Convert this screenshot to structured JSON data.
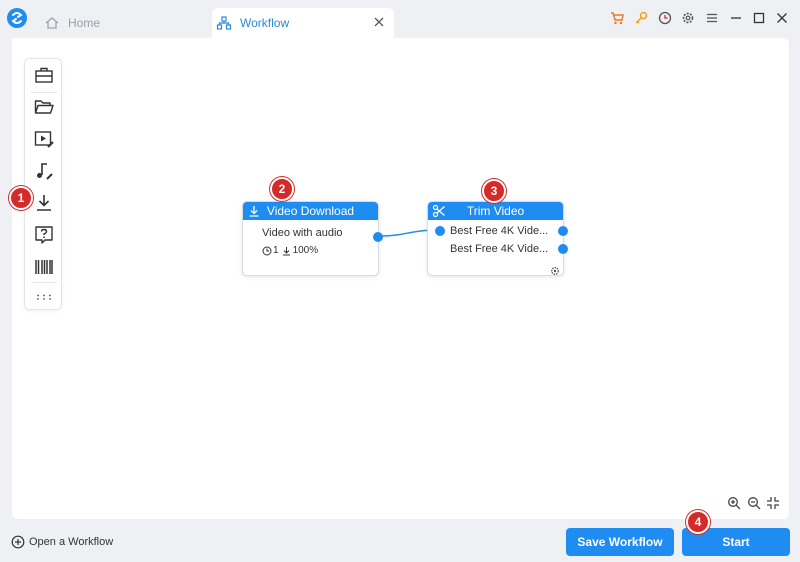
{
  "tabs": {
    "home_label": "Home",
    "workflow_label": "Workflow"
  },
  "colors": {
    "accent": "#1e8cf0",
    "badge": "#d42a2a",
    "key_icon": "#f0a020",
    "cart_icon": "#e8762c"
  },
  "title_icons": [
    "cart-icon",
    "key-icon",
    "clock-icon",
    "settings-icon",
    "menu-icon",
    "minimize-icon",
    "maximize-icon",
    "close-icon"
  ],
  "toolbox": {
    "tools": [
      "toolbox-icon",
      "folder-open-icon",
      "video-edit-icon",
      "audio-edit-icon",
      "download-icon",
      "help-icon",
      "barcode-icon",
      "more-icon"
    ]
  },
  "badges": [
    "1",
    "2",
    "3",
    "4"
  ],
  "nodes": {
    "download": {
      "title": "Video Download",
      "subtitle": "Video with audio",
      "count": "1",
      "progress": "100%"
    },
    "trim": {
      "title": "Trim Video",
      "inputs": [
        "Best Free 4K Vide...",
        "Best Free 4K Vide..."
      ]
    }
  },
  "bottom": {
    "open_workflow": "Open a Workflow",
    "save_label": "Save Workflow",
    "start_label": "Start"
  }
}
